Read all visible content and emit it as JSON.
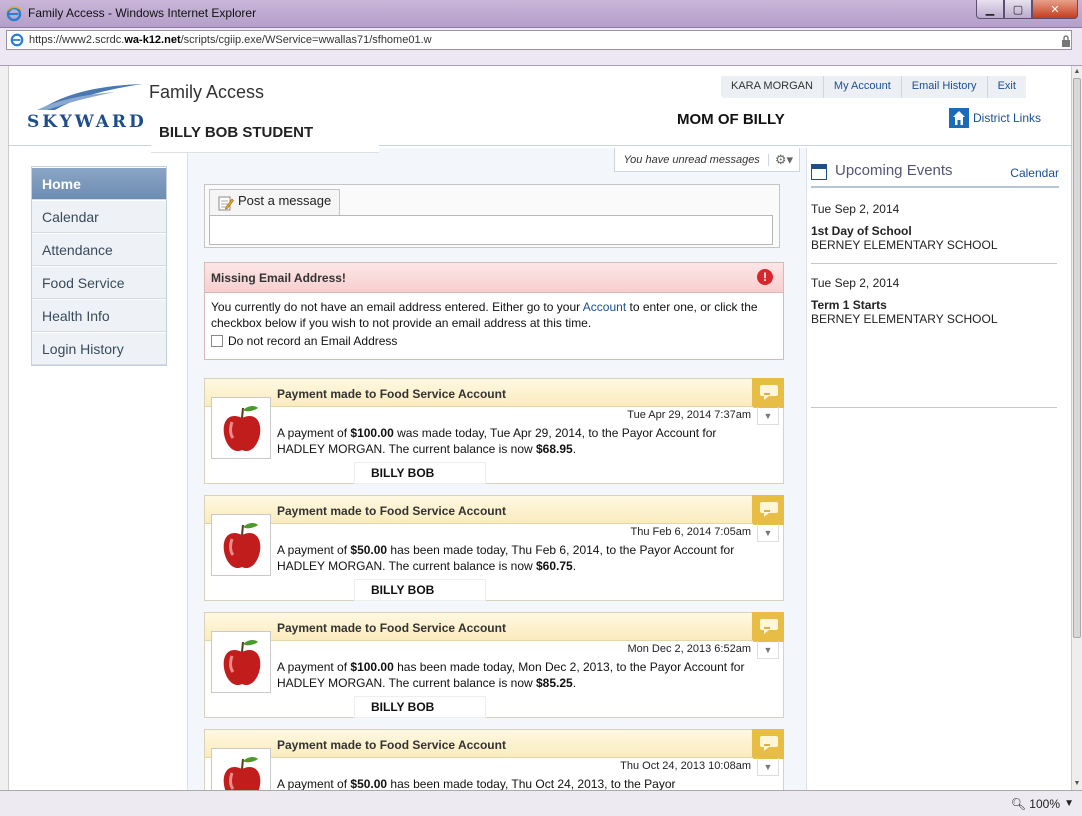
{
  "window": {
    "title": "Family Access - Windows Internet Explorer",
    "url_prefix": "https://www2.scrdc.",
    "url_domain": "wa-k12.net",
    "url_path": "/scripts/cgiip.exe/WService=wwallas71/sfhome01.w"
  },
  "header": {
    "logo_text": "SKYWARD",
    "app_title": "Family Access",
    "student_name": "BILLY BOB STUDENT",
    "user_label": "MOM OF BILLY",
    "nav": {
      "account_name": "KARA MORGAN",
      "my_account": "My Account",
      "email_history": "Email History",
      "exit": "Exit"
    },
    "district_links": "District Links"
  },
  "sidebar": {
    "items": [
      {
        "label": "Home",
        "active": true
      },
      {
        "label": "Calendar"
      },
      {
        "label": "Attendance"
      },
      {
        "label": "Food Service"
      },
      {
        "label": "Health Info"
      },
      {
        "label": "Login History"
      }
    ]
  },
  "main": {
    "unread_messages": "You have unread messages",
    "post_tab": "Post a message",
    "alert": {
      "title": "Missing Email Address!",
      "text_before": "You currently do not have an email address entered. Either go to your ",
      "account_link": "Account",
      "text_after": " to enter one, or click the checkbox below if you wish to not provide an email address at this time.",
      "checkbox_label": "Do not record an Email Address"
    },
    "cards": [
      {
        "title": "Payment made to Food Service Account",
        "date": "Tue Apr 29, 2014 7:37am",
        "t1": "A payment of ",
        "amount": "$100.00",
        "t2": " was made today, Tue Apr 29, 2014, to the Payor Account for HADLEY MORGAN. The current balance is now ",
        "balance": "$68.95",
        "t3": ".",
        "redact_label": "BILLY BOB"
      },
      {
        "title": "Payment made to Food Service Account",
        "date": "Thu Feb 6, 2014 7:05am",
        "t1": "A payment of ",
        "amount": "$50.00",
        "t2": " has been made today, Thu Feb 6, 2014, to the Payor Account for HADLEY MORGAN. The current balance is now ",
        "balance": "$60.75",
        "t3": ".",
        "redact_label": "BILLY BOB"
      },
      {
        "title": "Payment made to Food Service Account",
        "date": "Mon Dec 2, 2013 6:52am",
        "t1": "A payment of ",
        "amount": "$100.00",
        "t2": " has been made today, Mon Dec 2, 2013, to the Payor Account for HADLEY MORGAN. The current balance is now ",
        "balance": "$85.25",
        "t3": ".",
        "redact_label": "BILLY BOB"
      },
      {
        "title": "Payment made to Food Service Account",
        "date": "Thu Oct 24, 2013 10:08am",
        "t1": "A payment of ",
        "amount": "$50.00",
        "t2": " has been made today, Thu Oct 24, 2013, to the Payor",
        "balance": "",
        "t3": "",
        "redact_label": ""
      }
    ]
  },
  "events": {
    "title": "Upcoming Events",
    "calendar_link": "Calendar",
    "items": [
      {
        "date": "Tue Sep 2, 2014",
        "name": "1st Day of School",
        "school": "BERNEY ELEMENTARY SCHOOL"
      },
      {
        "date": "Tue Sep 2, 2014",
        "name": "Term 1 Starts",
        "school": "BERNEY ELEMENTARY SCHOOL"
      }
    ]
  },
  "status": {
    "zoom": "100%"
  },
  "colors": {
    "accent": "#1a4f95",
    "nav_active": "#6d8db3",
    "alert_icon": "#d9262c",
    "card_badge": "#e8bd45"
  }
}
